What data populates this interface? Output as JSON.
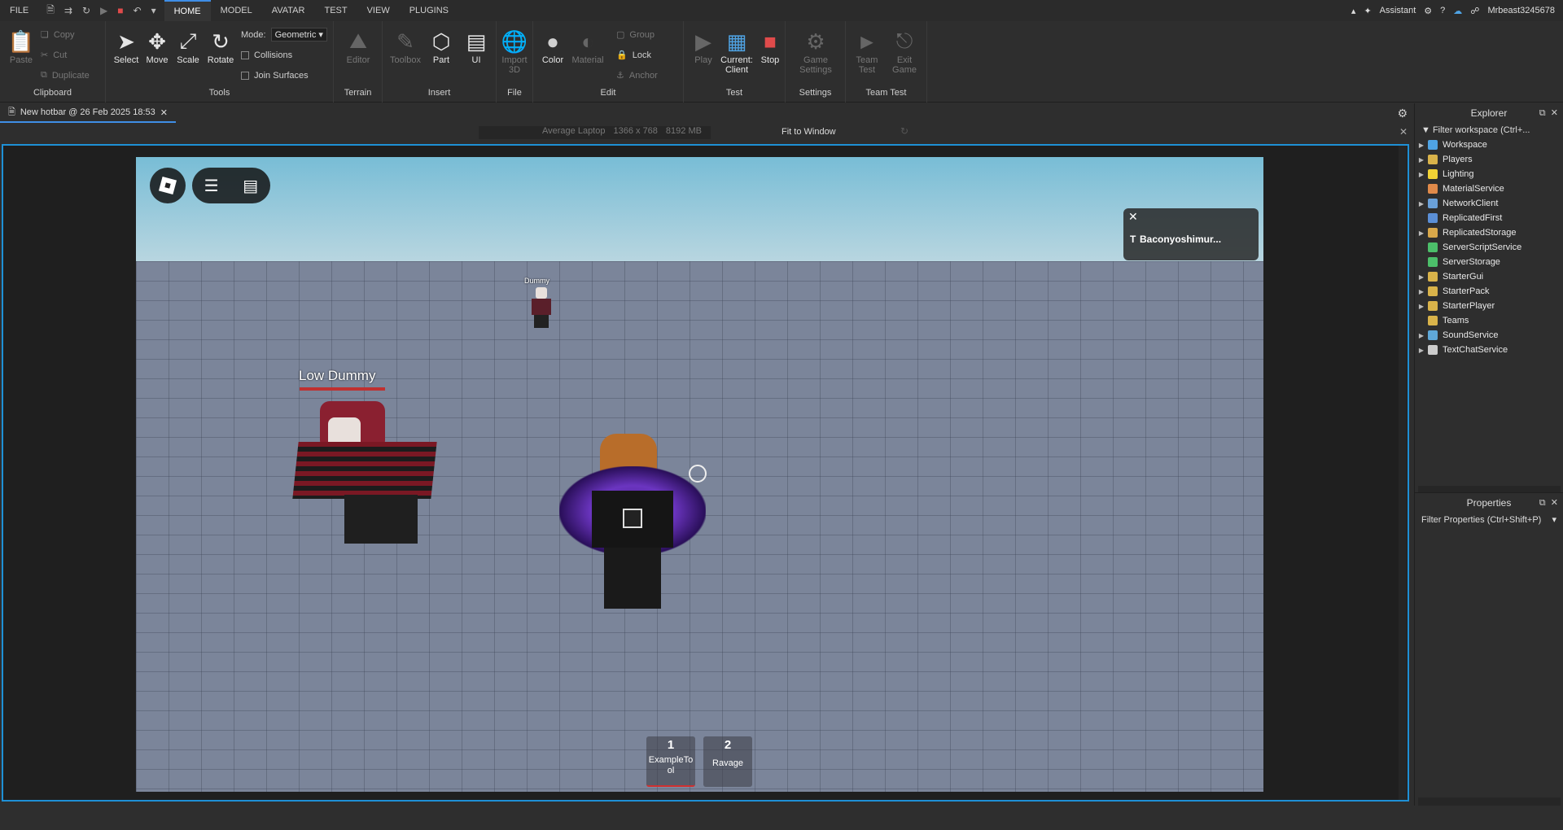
{
  "menubar": {
    "file": "FILE",
    "tabs": [
      "HOME",
      "MODEL",
      "AVATAR",
      "TEST",
      "VIEW",
      "PLUGINS"
    ],
    "assistant": "Assistant",
    "username": "Mrbeast3245678"
  },
  "ribbon": {
    "clipboard": {
      "label": "Clipboard",
      "paste": "Paste",
      "copy": "Copy",
      "cut": "Cut",
      "duplicate": "Duplicate"
    },
    "tools": {
      "label": "Tools",
      "select": "Select",
      "move": "Move",
      "scale": "Scale",
      "rotate": "Rotate",
      "mode_label": "Mode:",
      "mode_value": "Geometric",
      "collisions": "Collisions",
      "join_surfaces": "Join Surfaces"
    },
    "terrain": {
      "label": "Terrain",
      "editor": "Editor"
    },
    "insert": {
      "label": "Insert",
      "toolbox": "Toolbox",
      "part": "Part",
      "ui": "UI"
    },
    "file": {
      "label": "File",
      "import_3d": "Import 3D"
    },
    "edit": {
      "label": "Edit",
      "color": "Color",
      "material": "Material",
      "group": "Group",
      "lock": "Lock",
      "anchor": "Anchor"
    },
    "test": {
      "label": "Test",
      "play": "Play",
      "current_client": "Current: Client",
      "stop": "Stop"
    },
    "settings": {
      "label": "Settings",
      "game_settings": "Game Settings"
    },
    "team_test": {
      "label": "Team Test",
      "team_test": "Team Test",
      "exit_game": "Exit Game"
    }
  },
  "doc_tab": {
    "title": "New hotbar @ 26 Feb 2025 18:53"
  },
  "devbar": {
    "device": "Average Laptop",
    "resolution": "1366 x 768",
    "memory": "8192 MB",
    "fit": "Fit to Window"
  },
  "game": {
    "toast_text": "Baconyoshimur...",
    "dummy_far": "Dummy",
    "dummy_near": "Low Dummy",
    "hotbar": [
      {
        "num": "1",
        "label": "ExampleTool"
      },
      {
        "num": "2",
        "label": "Ravage"
      }
    ]
  },
  "explorer": {
    "title": "Explorer",
    "filter": "Filter workspace (Ctrl+...",
    "items": [
      {
        "label": "Workspace",
        "color": "#4fa3e3",
        "arrow": true
      },
      {
        "label": "Players",
        "color": "#d9b34a",
        "arrow": true
      },
      {
        "label": "Lighting",
        "color": "#f2d335",
        "arrow": true
      },
      {
        "label": "MaterialService",
        "color": "#e08a4a",
        "arrow": false
      },
      {
        "label": "NetworkClient",
        "color": "#6aa0d8",
        "arrow": true
      },
      {
        "label": "ReplicatedFirst",
        "color": "#5b8fd6",
        "arrow": false
      },
      {
        "label": "ReplicatedStorage",
        "color": "#d9a84a",
        "arrow": true
      },
      {
        "label": "ServerScriptService",
        "color": "#4cbf6a",
        "arrow": false
      },
      {
        "label": "ServerStorage",
        "color": "#4cbf6a",
        "arrow": false
      },
      {
        "label": "StarterGui",
        "color": "#d9b34a",
        "arrow": true
      },
      {
        "label": "StarterPack",
        "color": "#d9b34a",
        "arrow": true
      },
      {
        "label": "StarterPlayer",
        "color": "#d9b34a",
        "arrow": true
      },
      {
        "label": "Teams",
        "color": "#d9b34a",
        "arrow": false
      },
      {
        "label": "SoundService",
        "color": "#5fa8d8",
        "arrow": true
      },
      {
        "label": "TextChatService",
        "color": "#cccccc",
        "arrow": true
      }
    ]
  },
  "properties": {
    "title": "Properties",
    "filter": "Filter Properties (Ctrl+Shift+P)"
  }
}
